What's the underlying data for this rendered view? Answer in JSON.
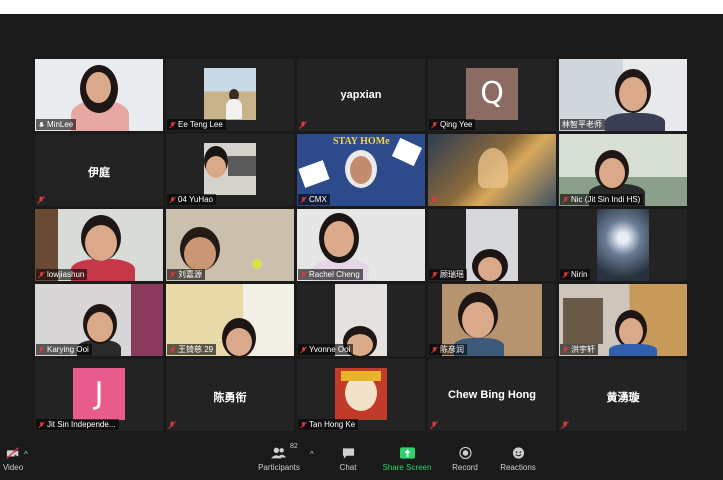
{
  "participants": [
    {
      "name": "MinLee",
      "muted": false,
      "active": true
    },
    {
      "name": "Ee Teng Lee",
      "muted": true
    },
    {
      "name": "",
      "center_name": "yapxian",
      "muted": true
    },
    {
      "name": "Qing Yee",
      "muted": true,
      "avatar_letter": "Q"
    },
    {
      "name": "林智平老师",
      "muted": false
    },
    {
      "name": "",
      "center_name": "伊庭",
      "muted": true
    },
    {
      "name": "04 YuHao",
      "muted": true
    },
    {
      "name": "CMX",
      "muted": true,
      "poster_text": "STAY HOMe"
    },
    {
      "name": "",
      "muted": true
    },
    {
      "name": "Nic (Jit Sin Indi HS)",
      "muted": true
    },
    {
      "name": "lowjiashun",
      "muted": true
    },
    {
      "name": "刘嘉源",
      "muted": true
    },
    {
      "name": "Rachel Cheng",
      "muted": true
    },
    {
      "name": "顾瑞瑶",
      "muted": true
    },
    {
      "name": "Nirin",
      "muted": true
    },
    {
      "name": "Karying Ooi",
      "muted": true
    },
    {
      "name": "王锜慈 29",
      "muted": true
    },
    {
      "name": "Yvonne Ooi",
      "muted": true
    },
    {
      "name": "陈彦润",
      "muted": true
    },
    {
      "name": "洪宇轩",
      "muted": true
    },
    {
      "name": "Jit Sin Independe...",
      "muted": true,
      "avatar_letter": "J"
    },
    {
      "name": "",
      "center_name": "陈勇衔",
      "muted": true
    },
    {
      "name": "Tan Hong Ke",
      "muted": true
    },
    {
      "name": "",
      "center_name": "Chew Bing Hong",
      "muted": true
    },
    {
      "name": "",
      "center_name": "黄湧璇",
      "muted": true
    }
  ],
  "toolbar": {
    "video_label": "Video",
    "participants_label": "Participants",
    "participants_count": "82",
    "chat_label": "Chat",
    "share_label": "Share Screen",
    "record_label": "Record",
    "reactions_label": "Reactions"
  },
  "colors": {
    "background": "#1a1a1a",
    "tile": "#232323",
    "active_border": "#c7d56a",
    "share_green": "#2fd36b",
    "muted_red": "#e0393e"
  }
}
